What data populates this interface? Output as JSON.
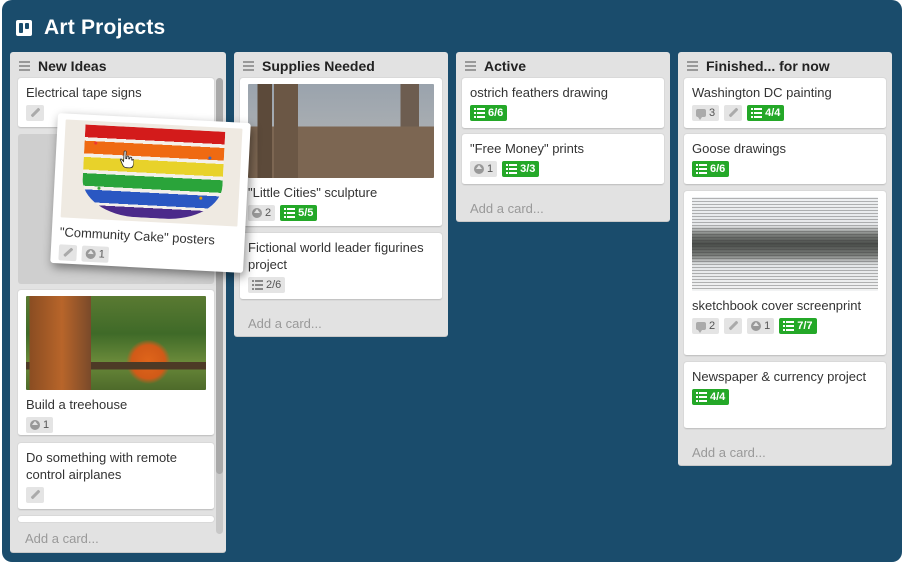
{
  "board": {
    "title": "Art Projects",
    "icon": "board-icon",
    "background_color": "#1a4c6c"
  },
  "colors": {
    "list_bg": "#e2e2e2",
    "card_bg": "#ffffff",
    "checklist_complete": "#24a828",
    "badge_bg": "#e4e4e4"
  },
  "lists": [
    {
      "title": "New Ideas",
      "add_card": "Add a card...",
      "cards": [
        {
          "title": "Electrical tape signs",
          "badges": {
            "description": true
          }
        },
        {
          "title": "Build a treehouse",
          "image": "treehouse",
          "badges": {
            "votes": "1"
          }
        },
        {
          "title": "Do something with remote control airplanes",
          "badges": {
            "description": true
          }
        }
      ]
    },
    {
      "title": "Supplies Needed",
      "add_card": "Add a card...",
      "cards": [
        {
          "title": "\"Little Cities\" sculpture",
          "image": "cardboard-city",
          "badges": {
            "votes": "2",
            "checklist": "5/5",
            "checklist_complete": true
          }
        },
        {
          "title": "Fictional world leader figurines project",
          "badges": {
            "checklist": "2/6",
            "checklist_complete": false
          }
        }
      ]
    },
    {
      "title": "Active",
      "add_card": "Add a card...",
      "cards": [
        {
          "title": "ostrich feathers drawing",
          "badges": {
            "checklist": "6/6",
            "checklist_complete": true
          }
        },
        {
          "title": "\"Free Money\" prints",
          "badges": {
            "votes": "1",
            "checklist": "3/3",
            "checklist_complete": true
          }
        }
      ]
    },
    {
      "title": "Finished... for now",
      "add_card": "Add a card...",
      "cards": [
        {
          "title": "Washington DC painting",
          "badges": {
            "comments": "3",
            "description": true,
            "checklist": "4/4",
            "checklist_complete": true
          }
        },
        {
          "title": "Goose drawings",
          "badges": {
            "checklist": "6/6",
            "checklist_complete": true
          }
        },
        {
          "title": "sketchbook cover screenprint",
          "image": "pencil-sketch",
          "badges": {
            "comments": "2",
            "description": true,
            "votes": "1",
            "checklist": "7/7",
            "checklist_complete": true
          }
        },
        {
          "title": "Newspaper & currency project",
          "badges": {
            "checklist": "4/4",
            "checklist_complete": true
          }
        }
      ]
    }
  ],
  "dragged_card": {
    "title": "\"Community Cake\" posters",
    "image": "rainbow-cake",
    "badges": {
      "description": true,
      "votes": "1"
    },
    "cursor": "hand-grab-cursor"
  }
}
